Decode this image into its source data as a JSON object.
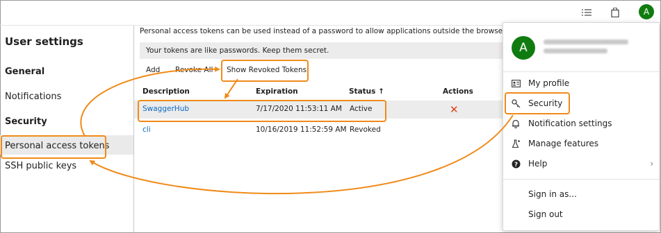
{
  "topbar": {
    "icons": [
      "list-icon",
      "shopping-bag-icon"
    ],
    "avatar_initial": "A"
  },
  "sidebar": {
    "title": "User settings",
    "sections": [
      {
        "heading": "General",
        "items": [
          "Notifications"
        ]
      },
      {
        "heading": "Security",
        "items": [
          "Personal access tokens",
          "SSH public keys"
        ]
      }
    ]
  },
  "main": {
    "description": "Personal access tokens can be used instead of a password to allow applications outside the browser access to",
    "warning": "Your tokens are like passwords. Keep them secret.",
    "toolbar": {
      "add": "Add",
      "revoke_all": "Revoke All",
      "show_revoked": "Show Revoked Tokens"
    },
    "columns": [
      "Description",
      "Expiration",
      "Status ↑",
      "Actions"
    ],
    "rows": [
      {
        "description": "SwaggerHub",
        "expiration": "7/17/2020 11:53:11 AM",
        "status": "Active",
        "action": "✕"
      },
      {
        "description": "cli",
        "expiration": "10/16/2019 11:52:59 AM",
        "status": "Revoked",
        "action": ""
      }
    ]
  },
  "menu": {
    "avatar_initial": "A",
    "items": [
      "My profile",
      "Security",
      "Notification settings",
      "Manage features",
      "Help"
    ],
    "footer": [
      "Sign in as...",
      "Sign out"
    ]
  },
  "colors": {
    "annotation": "#f08a18",
    "link": "#0b6ac5",
    "avatar": "#107c10",
    "revoke": "#e0421a"
  }
}
